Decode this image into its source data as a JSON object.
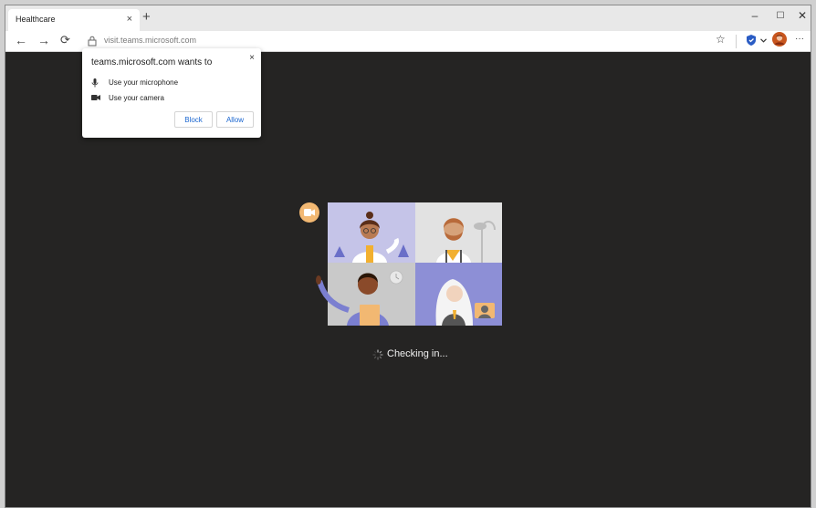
{
  "browser": {
    "tab": {
      "title": "Healthcare",
      "close_glyph": "×"
    },
    "new_tab_glyph": "+",
    "window_controls": {
      "minimize": "–",
      "maximize": "☐",
      "close": "✕"
    },
    "nav": {
      "back": "←",
      "forward": "→",
      "refresh": "⟳"
    },
    "address_bar": {
      "url": "visit.teams.microsoft.com"
    },
    "toolbar": {
      "favorite": "☆",
      "more": "···"
    }
  },
  "permission_popup": {
    "title": "teams.microsoft.com wants to",
    "close_glyph": "×",
    "permissions": [
      {
        "icon": "microphone-icon",
        "label": "Use your microphone"
      },
      {
        "icon": "camera-icon",
        "label": "Use your camera"
      }
    ],
    "block_label": "Block",
    "allow_label": "Allow"
  },
  "status": {
    "text": "Checking in...",
    "spinner_icon": "spinner-icon"
  },
  "colors": {
    "page_bg": "#252423",
    "accent_blue": "#1a66d0",
    "illustration_purple": "#7b7fd0",
    "camera_badge": "#f2b872"
  }
}
